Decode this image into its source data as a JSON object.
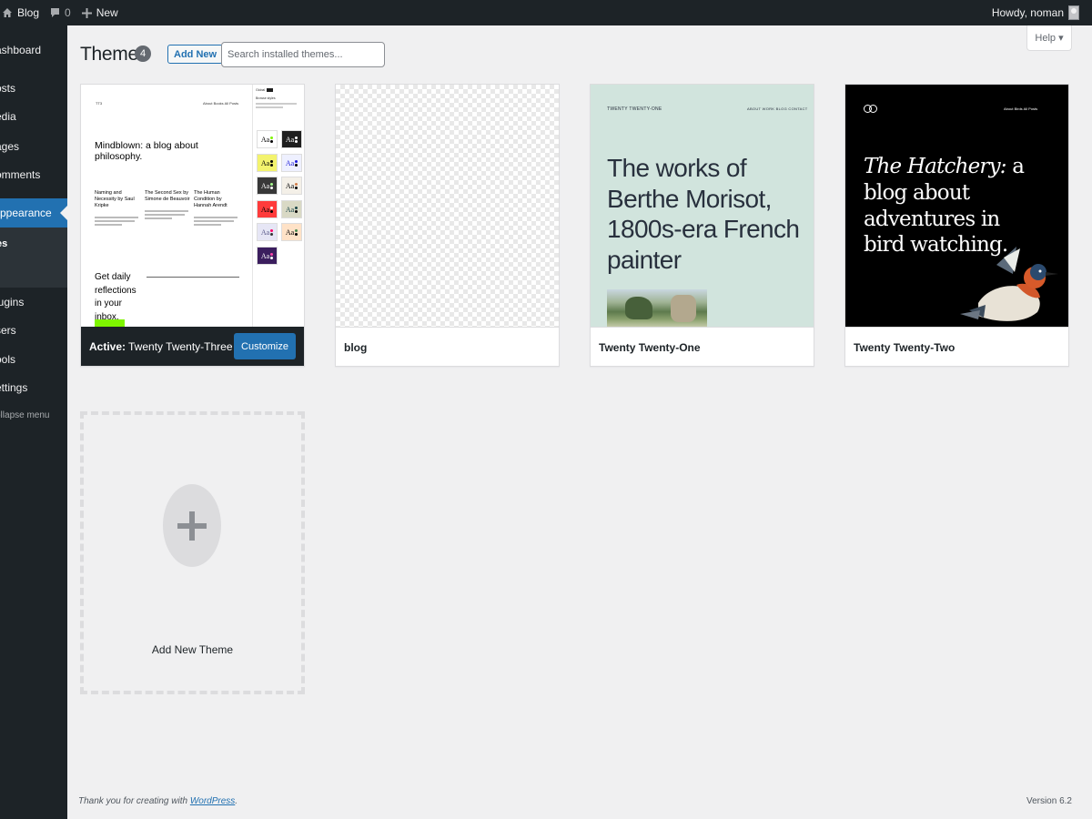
{
  "admin_bar": {
    "site_name": "Blog",
    "comments_count": "0",
    "new_label": "New",
    "greeting": "Howdy, noman"
  },
  "sidebar": {
    "items": [
      {
        "label": "ashboard"
      },
      {
        "label": "osts"
      },
      {
        "label": "edia"
      },
      {
        "label": "ages"
      },
      {
        "label": "omments"
      },
      {
        "label": "ppearance"
      },
      {
        "label": "es"
      },
      {
        "label": "lugins"
      },
      {
        "label": "sers"
      },
      {
        "label": "ools"
      },
      {
        "label": "ettings"
      },
      {
        "label": "ollapse menu"
      }
    ]
  },
  "header": {
    "title": "Themes",
    "count": "4",
    "add_new_label": "Add New",
    "search_placeholder": "Search installed themes...",
    "help_label": "Help ▾"
  },
  "themes": [
    {
      "active_prefix": "Active:",
      "name": "Twenty Twenty-Three",
      "customize_label": "Customize",
      "preview": {
        "logo": "TT3",
        "nav": "About   Books   All Posts",
        "headline": "Mindblown: a blog about philosophy.",
        "columns": [
          {
            "title": "Naming and Necessity by Saul Kripke"
          },
          {
            "title": "The Second Sex by Simone de Beauvoir"
          },
          {
            "title": "The Human Condition by Hannah Arendt"
          }
        ],
        "cta": "Get daily reflections in your inbox.",
        "panel_head": "Global",
        "panel_title": "Browse styles",
        "swatch_text": "Aa"
      }
    },
    {
      "name": "blog"
    },
    {
      "name": "Twenty Twenty-One",
      "preview": {
        "site_title": "TWENTY TWENTY-ONE",
        "nav": "ABOUT   WORK   BLOG   CONTACT",
        "headline": "The works of Berthe Morisot, 1800s-era French painter"
      }
    },
    {
      "name": "Twenty Twenty-Two",
      "preview": {
        "nav": "About   Birds   All Posts",
        "headline_italic": "The Hatchery:",
        "headline_rest": " a blog about adventures in bird watching."
      }
    }
  ],
  "add_new_theme": {
    "label": "Add New Theme"
  },
  "footer": {
    "thanks_prefix": "Thank you for creating with ",
    "link_text": "WordPress",
    "thanks_suffix": ".",
    "version": "Version 6.2"
  },
  "colors": {
    "accent": "#2271b1",
    "admin_dark": "#1d2327",
    "background": "#f0f0f1"
  }
}
